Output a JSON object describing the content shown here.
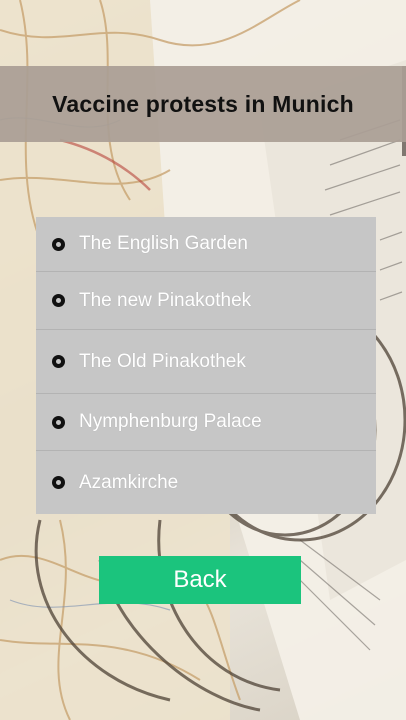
{
  "title": "Vaccine protests in Munich",
  "options": [
    {
      "label": "The English Garden"
    },
    {
      "label": "The new Pinakothek"
    },
    {
      "label": "The Old Pinakothek"
    },
    {
      "label": "Nymphenburg Palace"
    },
    {
      "label": "Azamkirche"
    }
  ],
  "back_label": "Back",
  "colors": {
    "title_bar": "#aa9e94",
    "options_bg": "#c6c6c6",
    "back_button": "#1bc47d",
    "option_text": "#ffffff"
  },
  "icons": {
    "radio": "radio-unselected-icon"
  }
}
